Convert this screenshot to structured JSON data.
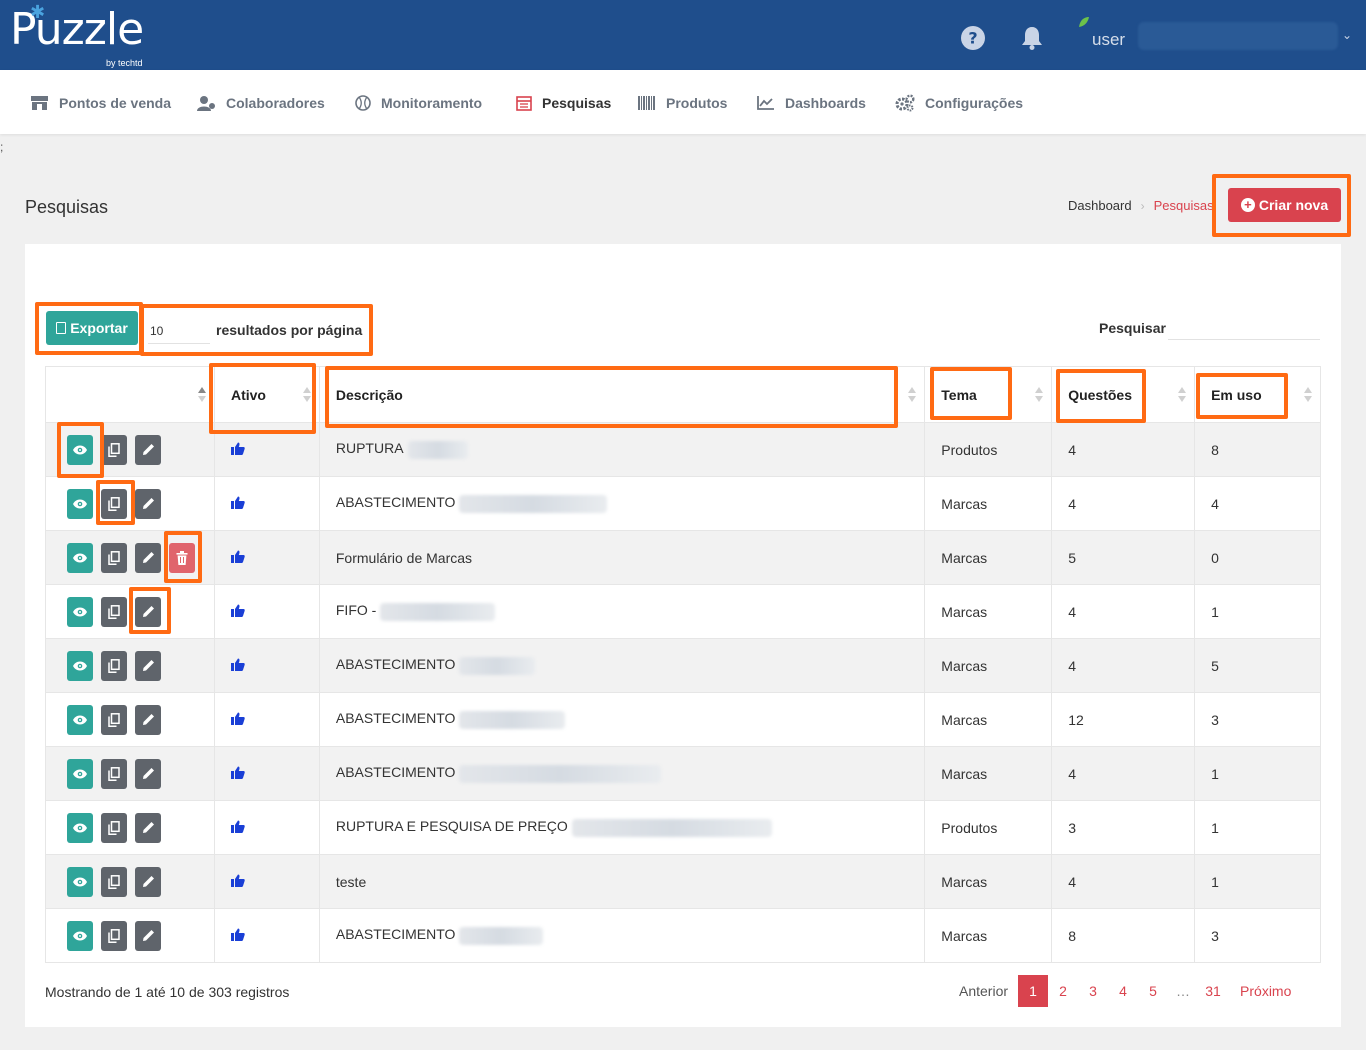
{
  "app": {
    "logo_text": "Puzzle",
    "logo_byline": "by techtd",
    "user_label": "user"
  },
  "nav": [
    {
      "label": "Pontos de venda",
      "icon": "store-icon"
    },
    {
      "label": "Colaboradores",
      "icon": "users-icon"
    },
    {
      "label": "Monitoramento",
      "icon": "tennis-ball-icon"
    },
    {
      "label": "Pesquisas",
      "icon": "calendar-list-icon",
      "active": true
    },
    {
      "label": "Produtos",
      "icon": "barcode-icon"
    },
    {
      "label": "Dashboards",
      "icon": "chart-line-icon"
    },
    {
      "label": "Configurações",
      "icon": "gears-icon"
    }
  ],
  "stray_char": ";",
  "page": {
    "title": "Pesquisas",
    "breadcrumb": [
      "Dashboard",
      "Pesquisas"
    ],
    "create_button": "Criar nova"
  },
  "toolbar": {
    "export_label": "Exportar",
    "per_page_value": "10",
    "per_page_label": "resultados por página",
    "search_label": "Pesquisar"
  },
  "table": {
    "columns": [
      "",
      "Ativo",
      "Descrição",
      "Tema",
      "Questões",
      "Em uso"
    ],
    "rows": [
      {
        "descricao": "RUPTURA",
        "tema": "Produtos",
        "questoes": "4",
        "em_uso": "8",
        "deletable": false
      },
      {
        "descricao": "ABASTECIMENTO",
        "tema": "Marcas",
        "questoes": "4",
        "em_uso": "4",
        "deletable": false
      },
      {
        "descricao": "Formulário de Marcas",
        "tema": "Marcas",
        "questoes": "5",
        "em_uso": "0",
        "deletable": true
      },
      {
        "descricao": "FIFO -",
        "tema": "Marcas",
        "questoes": "4",
        "em_uso": "1",
        "deletable": false
      },
      {
        "descricao": "ABASTECIMENTO",
        "tema": "Marcas",
        "questoes": "4",
        "em_uso": "5",
        "deletable": false
      },
      {
        "descricao": "ABASTECIMENTO",
        "tema": "Marcas",
        "questoes": "12",
        "em_uso": "3",
        "deletable": false
      },
      {
        "descricao": "ABASTECIMENTO",
        "tema": "Marcas",
        "questoes": "4",
        "em_uso": "1",
        "deletable": false
      },
      {
        "descricao": "RUPTURA E PESQUISA DE PREÇO",
        "tema": "Produtos",
        "questoes": "3",
        "em_uso": "1",
        "deletable": false
      },
      {
        "descricao": "teste",
        "tema": "Marcas",
        "questoes": "4",
        "em_uso": "1",
        "deletable": false
      },
      {
        "descricao": "ABASTECIMENTO",
        "tema": "Marcas",
        "questoes": "8",
        "em_uso": "3",
        "deletable": false
      }
    ]
  },
  "footer": {
    "info": "Mostrando de 1 até 10 de 303 registros",
    "prev": "Anterior",
    "pages": [
      "1",
      "2",
      "3",
      "4",
      "5",
      "…",
      "31"
    ],
    "next": "Próximo",
    "current_page": "1"
  },
  "colors": {
    "header_bg": "#1f4e8c",
    "accent_red": "#d9434e",
    "teal": "#2fa59a",
    "thumb_blue": "#1a3fd6",
    "highlight": "#ff6a13"
  }
}
